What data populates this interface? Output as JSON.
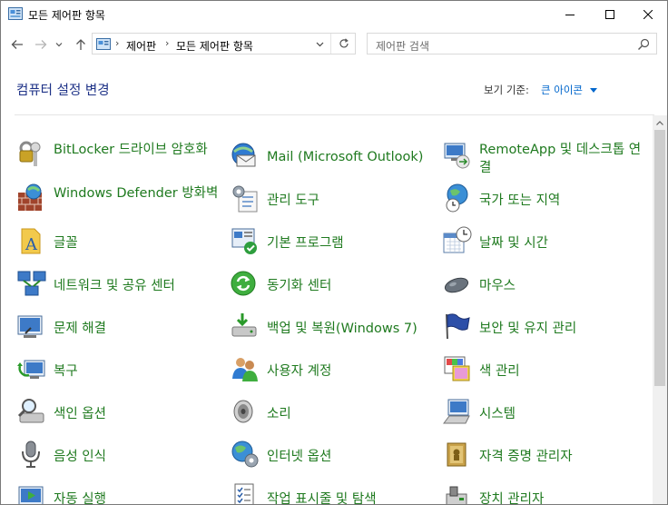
{
  "window": {
    "title": "모든 제어판 항목"
  },
  "nav": {
    "breadcrumb": [
      "제어판",
      "모든 제어판 항목"
    ],
    "search_placeholder": "제어판 검색"
  },
  "header": {
    "heading": "컴퓨터 설정 변경",
    "view_by_label": "보기 기준:",
    "view_by_value": "큰 아이콘"
  },
  "colors": {
    "item_text": "#1f7a1f",
    "heading": "#1e3287",
    "link": "#0066cc"
  },
  "items": [
    {
      "label": "BitLocker 드라이브 암호화",
      "icon": "key-lock-icon"
    },
    {
      "label": "Mail (Microsoft Outlook)",
      "icon": "mail-icon"
    },
    {
      "label": "RemoteApp 및 데스크톱 연결",
      "icon": "remoteapp-icon"
    },
    {
      "label": "Windows Defender 방화벽",
      "icon": "firewall-icon"
    },
    {
      "label": "관리 도구",
      "icon": "admin-tools-icon"
    },
    {
      "label": "국가 또는 지역",
      "icon": "globe-clock-icon"
    },
    {
      "label": "글꼴",
      "icon": "font-icon"
    },
    {
      "label": "기본 프로그램",
      "icon": "default-programs-icon"
    },
    {
      "label": "날짜 및 시간",
      "icon": "calendar-clock-icon"
    },
    {
      "label": "네트워크 및 공유 센터",
      "icon": "network-icon"
    },
    {
      "label": "동기화 센터",
      "icon": "sync-icon"
    },
    {
      "label": "마우스",
      "icon": "mouse-icon"
    },
    {
      "label": "문제 해결",
      "icon": "troubleshoot-icon"
    },
    {
      "label": "백업 및 복원(Windows 7)",
      "icon": "backup-icon"
    },
    {
      "label": "보안 및 유지 관리",
      "icon": "flag-icon"
    },
    {
      "label": "복구",
      "icon": "recovery-icon"
    },
    {
      "label": "사용자 계정",
      "icon": "users-icon"
    },
    {
      "label": "색 관리",
      "icon": "color-management-icon"
    },
    {
      "label": "색인 옵션",
      "icon": "indexing-icon"
    },
    {
      "label": "소리",
      "icon": "speaker-icon"
    },
    {
      "label": "시스템",
      "icon": "system-icon"
    },
    {
      "label": "음성 인식",
      "icon": "microphone-icon"
    },
    {
      "label": "인터넷 옵션",
      "icon": "internet-options-icon"
    },
    {
      "label": "자격 증명 관리자",
      "icon": "credential-icon"
    },
    {
      "label": "자동 실행",
      "icon": "autoplay-icon"
    },
    {
      "label": "작업 표시줄 및 탐색",
      "icon": "taskbar-icon"
    },
    {
      "label": "장치 관리자",
      "icon": "device-manager-icon"
    }
  ]
}
